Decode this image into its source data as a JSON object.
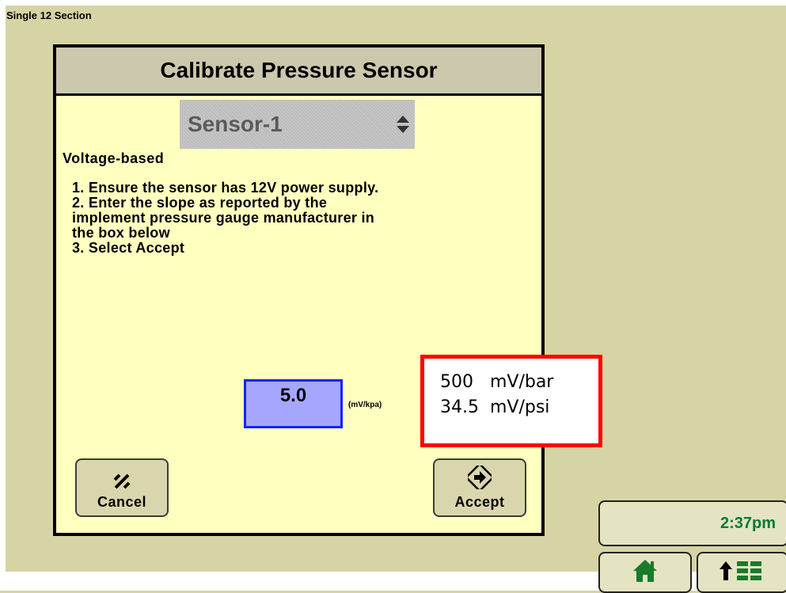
{
  "app": {
    "title": "Single 12 Section"
  },
  "dialog": {
    "title": "Calibrate Pressure Sensor",
    "sensor_select": {
      "value": "Sensor-1"
    },
    "mode_label": "Voltage-based",
    "instructions": [
      "1. Ensure the sensor has 12V power supply.",
      "2. Enter the slope as reported by the",
      "implement pressure gauge manufacturer in",
      "the box below",
      "3. Select Accept"
    ],
    "slope_input": {
      "value": "5.0",
      "unit": "(mV/kpa)"
    },
    "cancel_label": "Cancel",
    "accept_label": "Accept"
  },
  "callout": {
    "lines": [
      "500   mV/bar",
      "34.5  mV/psi"
    ],
    "border_color": "#ff0000"
  },
  "status": {
    "time": "2:37pm"
  },
  "nav": {
    "home_icon": "home-icon",
    "menu_icon": "menu-icon"
  },
  "colors": {
    "background": "#d6d4a4",
    "dialog": "#ffffc0",
    "input": "#a6a6ff",
    "time": "#007a33"
  }
}
